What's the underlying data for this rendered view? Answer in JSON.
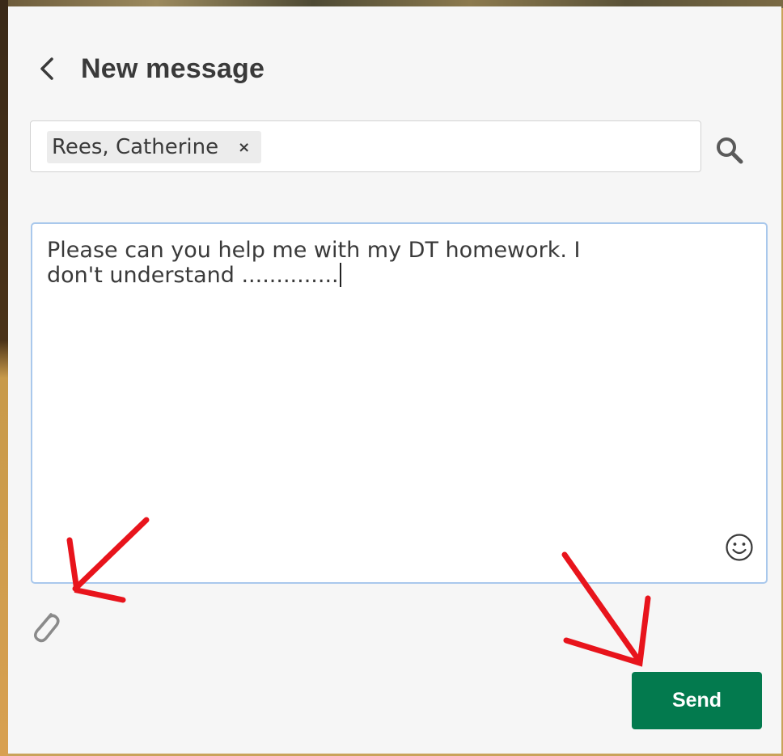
{
  "header": {
    "back_icon": "chevron-left-icon",
    "title": "New message"
  },
  "recipients": {
    "chips": [
      {
        "label": "Rees, Catherine",
        "remove_label": "×"
      }
    ],
    "search_icon": "search-icon"
  },
  "composer": {
    "message": "Please can you help me with my DT homework. I\ndon't understand ..............",
    "emoji_icon": "smiley-icon",
    "attach_icon": "paperclip-icon"
  },
  "actions": {
    "send_label": "Send"
  },
  "colors": {
    "send_button": "#037a4e",
    "focus_border": "#a9c8ec",
    "annotation_arrows": "#e8141c",
    "panel_background": "#f6f6f6"
  }
}
